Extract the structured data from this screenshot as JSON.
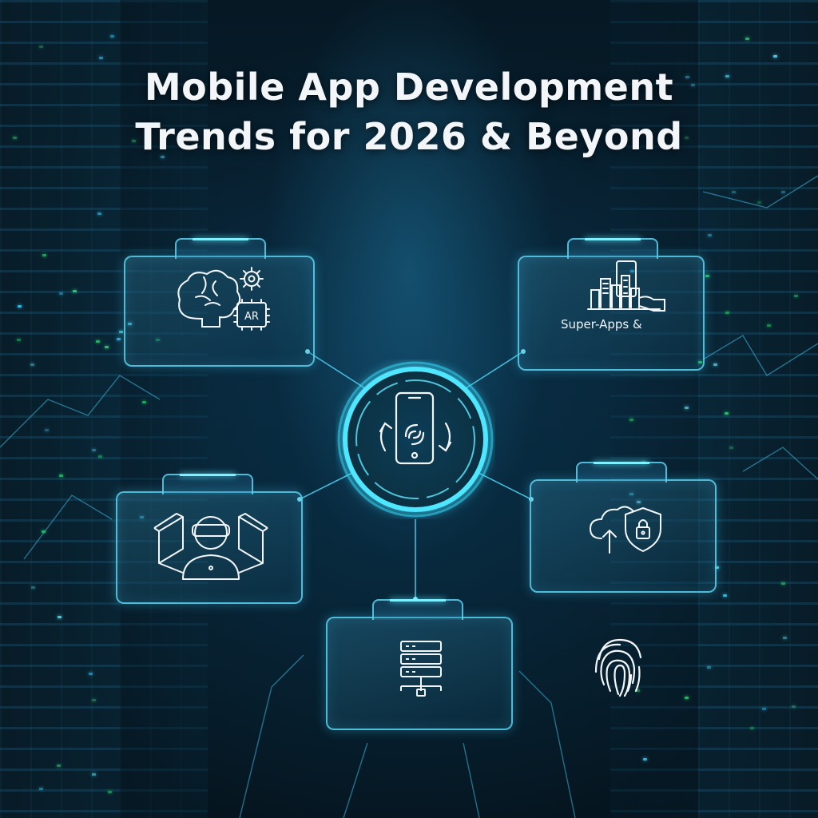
{
  "title": {
    "line1": "Mobile App Development",
    "line2": "Trends for 2026 & Beyond"
  },
  "cards": {
    "top_right_label": "Super-Apps &"
  },
  "icons": {
    "hub": "smartphone-sync-icon",
    "top_left": "brain-ai-ar-icon",
    "top_right": "super-app-city-icon",
    "mid_left": "vr-user-icon",
    "mid_right": "cloud-security-icon",
    "bottom": "server-stack-icon",
    "bottom_right": "fingerprint-icon"
  },
  "colors": {
    "accent": "#5fe8ff",
    "card_border": "#5ad2f0",
    "text": "#f2f6f8",
    "background": "#04121c"
  }
}
